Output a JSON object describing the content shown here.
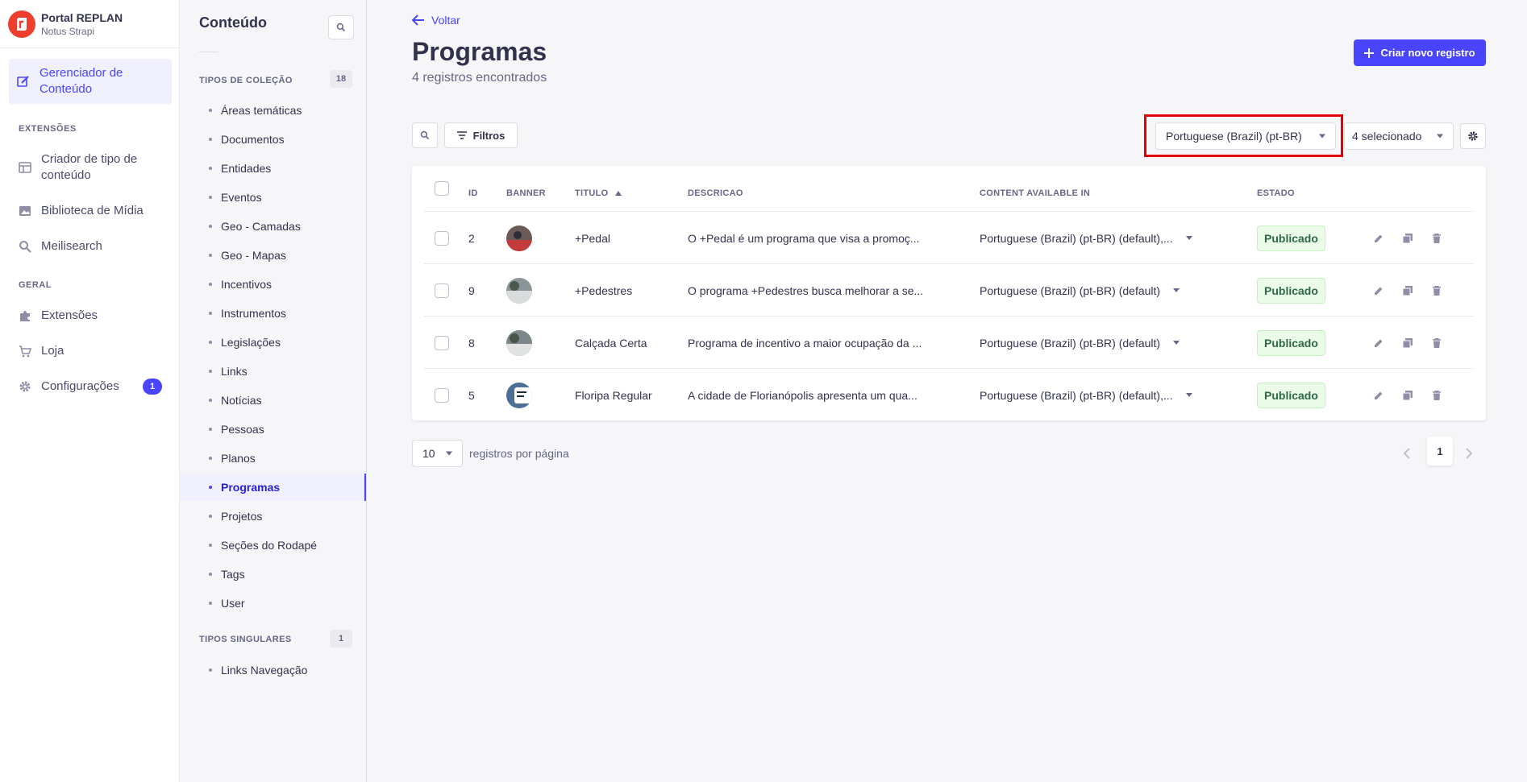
{
  "brand": {
    "title": "Portal REPLAN",
    "subtitle": "Notus Strapi",
    "accent": "#ee3f2e"
  },
  "mainnav": {
    "active": {
      "label_line1": "Gerenciador de",
      "label_line2": "Conteúdo"
    },
    "sections": {
      "extensoes": "EXTENSÕES",
      "geral": "GERAL"
    },
    "items": {
      "criador_line1": "Criador de tipo de",
      "criador_line2": "conteúdo",
      "biblioteca": "Biblioteca de Mídia",
      "meilisearch": "Meilisearch",
      "extensoes": "Extensões",
      "loja": "Loja",
      "configuracoes": "Configurações",
      "configuracoes_badge": "1"
    }
  },
  "subnav": {
    "title": "Conteúdo",
    "collection_section": "TIPOS DE COLEÇÃO",
    "collection_count": "18",
    "collection_items": [
      "Áreas temáticas",
      "Documentos",
      "Entidades",
      "Eventos",
      "Geo - Camadas",
      "Geo - Mapas",
      "Incentivos",
      "Instrumentos",
      "Legislações",
      "Links",
      "Notícias",
      "Pessoas",
      "Planos",
      "Programas",
      "Projetos",
      "Seções do Rodapé",
      "Tags",
      "User"
    ],
    "active_item": "Programas",
    "single_section": "TIPOS SINGULARES",
    "single_count": "1",
    "single_items": [
      "Links Navegação"
    ]
  },
  "header": {
    "back": "Voltar",
    "title": "Programas",
    "subtitle": "4 registros encontrados",
    "create_button": "Criar novo registro"
  },
  "toolbar": {
    "filters": "Filtros",
    "locale": "Portuguese (Brazil) (pt-BR)",
    "columns": "4 selecionado"
  },
  "table": {
    "headers": {
      "id": "ID",
      "banner": "BANNER",
      "titulo": "TITULO",
      "descricao": "DESCRICAO",
      "content": "CONTENT AVAILABLE IN",
      "estado": "ESTADO"
    },
    "rows": [
      {
        "id": "2",
        "titulo": "+Pedal",
        "descricao": "O +Pedal é um programa que visa a promoç...",
        "content": "Portuguese (Brazil) (pt-BR) (default),...",
        "estado": "Publicado"
      },
      {
        "id": "9",
        "titulo": "+Pedestres",
        "descricao": "O programa +Pedestres busca melhorar a se...",
        "content": "Portuguese (Brazil) (pt-BR) (default)",
        "estado": "Publicado"
      },
      {
        "id": "8",
        "titulo": "Calçada Certa",
        "descricao": "Programa de incentivo a maior ocupação da ...",
        "content": "Portuguese (Brazil) (pt-BR) (default)",
        "estado": "Publicado"
      },
      {
        "id": "5",
        "titulo": "Floripa Regular",
        "descricao": "A cidade de Florianópolis apresenta um qua...",
        "content": "Portuguese (Brazil) (pt-BR) (default),...",
        "estado": "Publicado"
      }
    ]
  },
  "pagination": {
    "per_page": "10",
    "per_page_label": "registros por página",
    "current_page": "1"
  },
  "colors": {
    "primary": "#4945ff",
    "success_bg": "#eafbe7",
    "success_text": "#2f6846",
    "highlight": "#e30000"
  }
}
